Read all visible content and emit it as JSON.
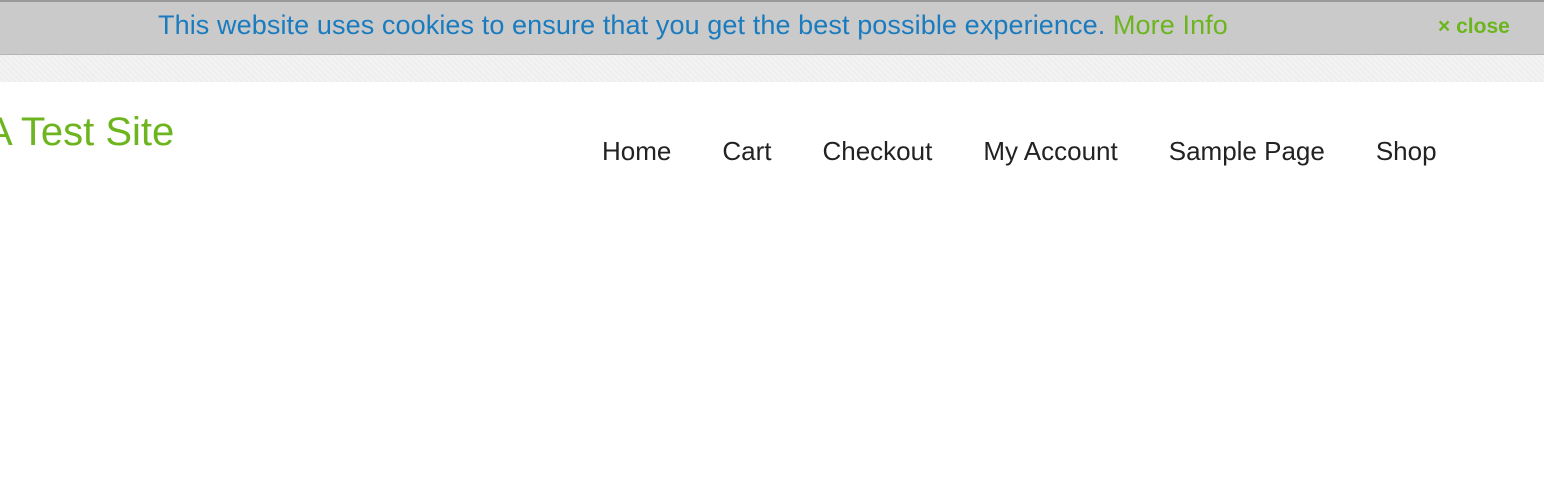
{
  "cookie_banner": {
    "message": "This website uses cookies to ensure that you get the best possible experience.",
    "more_info_label": "More Info",
    "close_icon": "×",
    "close_label": "close",
    "colors": {
      "background": "#cacaca",
      "message": "#1a7bbf",
      "link": "#6db51f"
    }
  },
  "header": {
    "site_title": "A Test Site",
    "nav": [
      {
        "label": "Home"
      },
      {
        "label": "Cart"
      },
      {
        "label": "Checkout"
      },
      {
        "label": "My Account"
      },
      {
        "label": "Sample Page"
      },
      {
        "label": "Shop"
      }
    ]
  }
}
